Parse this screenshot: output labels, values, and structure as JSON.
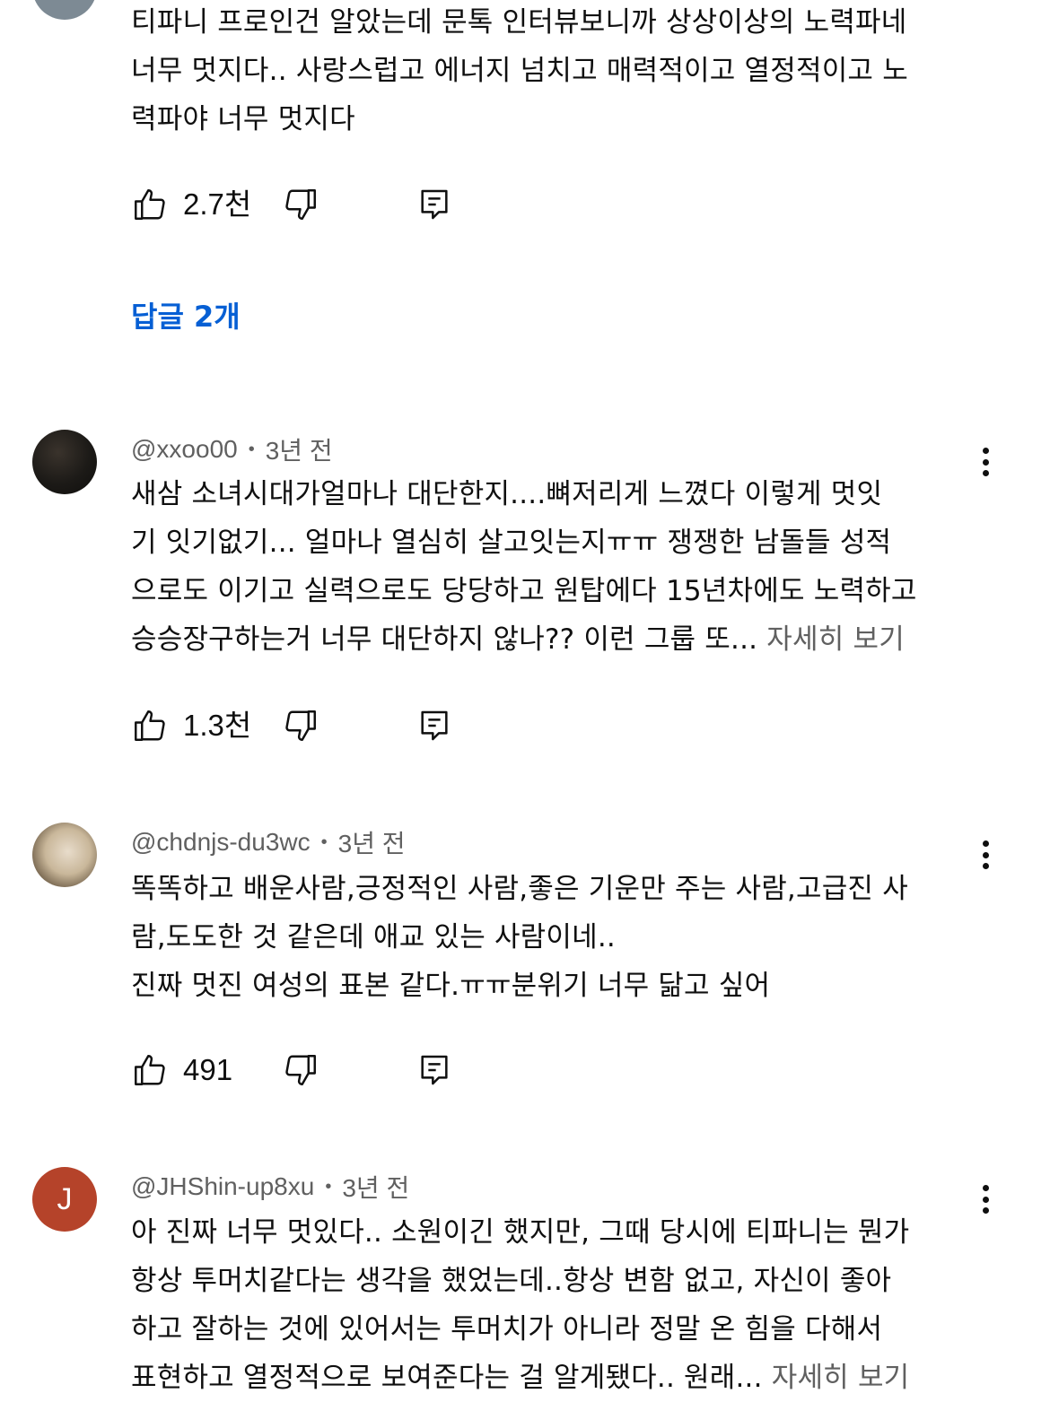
{
  "comments": [
    {
      "author": "",
      "time": "",
      "lines": [
        "티파니 프로인건 알았는데 문톡 인터뷰보니까 상상이상의 노력파네",
        "너무 멋지다.. 사랑스럽고 에너지 넘치고 매력적이고 열정적이고 노",
        "력파야 너무 멋지다"
      ],
      "read_more": "",
      "likes": "2.7천",
      "replies_label": "답글 2개",
      "avatar_color": "#7d8a94"
    },
    {
      "author": "@xxoo00",
      "time": "3년 전",
      "lines": [
        "새삼 소녀시대가얼마나 대단한지....뼈저리게 느꼈다  이렇게 멋잇",
        "기 잇기없기... 얼마나 열심히 살고잇는지ㅠㅠ 쟁쟁한 남돌들 성적",
        "으로도 이기고 실력으로도 당당하고 원탑에다 15년차에도 노력하고",
        "승승장구하는거 너무 대단하지 않나?? 이런 그룹 또..."
      ],
      "read_more": "자세히 보기",
      "likes": "1.3천",
      "avatar_color": "#1c1a17"
    },
    {
      "author": "@chdnjs-du3wc",
      "time": "3년 전",
      "lines": [
        "똑똑하고 배운사람,긍정적인 사람,좋은 기운만 주는 사람,고급진 사",
        "람,도도한 것 같은데 애교 있는 사람이네..",
        "진짜 멋진 여성의 표본 같다.ㅠㅠ분위기 너무 닮고 싶어"
      ],
      "read_more": "",
      "likes": "491",
      "avatar_color": "#c9b79a"
    },
    {
      "author": "@JHShin-up8xu",
      "time": "3년 전",
      "avatar_letter": "J",
      "lines": [
        "아 진짜 너무 멋있다.. 소원이긴 했지만, 그때 당시에 티파니는 뭔가",
        "항상 투머치같다는 생각을 했었는데..항상 변함 없고, 자신이 좋아",
        "하고 잘하는 것에 있어서는 투머치가 아니라 정말 온 힘을 다해서",
        "표현하고 열정적으로 보여준다는 걸 알게됐다.. 원래..."
      ],
      "read_more": "자세히 보기",
      "avatar_color": "#b5432a"
    }
  ],
  "icons": {
    "like": "thumbs-up-icon",
    "dislike": "thumbs-down-icon",
    "reply": "reply-icon",
    "more": "more-vert-icon"
  },
  "colors": {
    "replies_link": "#065fd4",
    "meta_text": "#606060"
  }
}
